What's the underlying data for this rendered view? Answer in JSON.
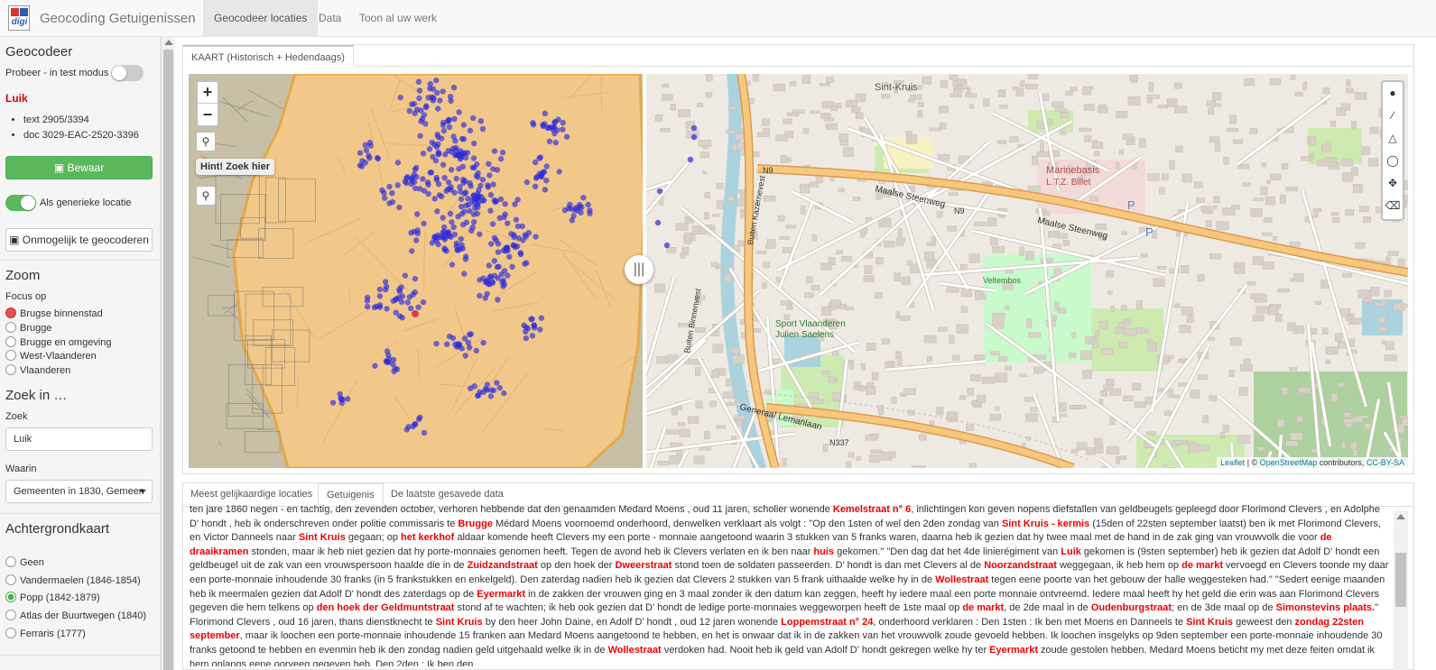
{
  "app": {
    "logo_text": "digi",
    "title": "Geocoding Getuigenissen",
    "nav": [
      {
        "label": "Geocodeer locaties"
      },
      {
        "label": "Data"
      },
      {
        "label": "Toon al uw werk"
      }
    ]
  },
  "sidebar": {
    "geocodeer": {
      "heading": "Geocodeer",
      "test_mode_label": "Probeer - in test modus",
      "test_mode": false,
      "location": "Luik",
      "details": [
        "text 2905/3394",
        "doc 3029-EAC-2520-3396"
      ],
      "save_label": "Bewaar",
      "generic_label": "Als generieke locatie",
      "generic": true,
      "impossible_label": "Onmogelijk te geocoderen"
    },
    "zoom": {
      "heading": "Zoom",
      "focus_label": "Focus op",
      "options": [
        "Brugse binnenstad",
        "Brugge",
        "Brugge en omgeving",
        "West-Vlaanderen",
        "Vlaanderen"
      ],
      "selected": 0
    },
    "search": {
      "heading": "Zoek in …",
      "query_label": "Zoek",
      "query_value": "Luik",
      "where_label": "Waarin",
      "where_value": "Gemeenten in 1830, Gemeen"
    },
    "background": {
      "heading": "Achtergrondkaart",
      "options": [
        "Geen",
        "Vandermaelen (1846-1854)",
        "Popp (1842-1879)",
        "Atlas der Buurtwegen (1840)",
        "Ferraris (1777)"
      ],
      "selected": 2
    }
  },
  "map_panel": {
    "tab": "KAART (Historisch + Hedendaags)",
    "zoom_in": "+",
    "zoom_out": "−",
    "hint": "Hint! Zoek hier",
    "attribution": {
      "leaflet": "Leaflet",
      "sep": "| ©",
      "osm": "OpenStreetMap",
      "contrib": "contributors,",
      "license": "CC-BY-SA"
    },
    "labels": {
      "sint_kruis": "Sint-Kruis",
      "maalse_1": "Maalse Steenweg",
      "maalse_2": "Maalse Steenweg",
      "marinebasis": "Marinebasis",
      "ltz": "L.T.Z. Billet",
      "sport": "Sport Vlaanderen",
      "saelens": "Julien Saelens",
      "veltembos": "Veltembos",
      "leman": "Generaal Lemanlaan",
      "kazernevest": "Buiten Kazernevest",
      "binnenvest": "Buiten Binnenvest",
      "n9a": "N9",
      "n9b": "N9",
      "n337": "N337",
      "p": "P"
    },
    "colors": {
      "dots": "#2b2bdc",
      "historic": "#f2c88a",
      "road": "#f7c77e"
    }
  },
  "bottom_panel": {
    "tabs": [
      {
        "label": "Meest gelijkaardige locaties"
      },
      {
        "label": "Getuigenis"
      },
      {
        "label": "De laatste gesavede data"
      }
    ],
    "active_tab": 1,
    "segments": [
      {
        "t": "ten jare 1860 negen - en tachtig, den zevenden october, verhoren hebbende dat den genaamden Medard Moens , oud 11 jaren, scholier wonende "
      },
      {
        "t": "Kemelstraat n° 6",
        "h": true
      },
      {
        "t": ", inlichtingen kon geven nopens diefstallen van geldbeugels gepleegd door Florimond Clevers , en Adolphe D' hondt , heb ik onderschreven onder politie commissaris te "
      },
      {
        "t": "Brugge",
        "h": true
      },
      {
        "t": " Médard Moens voornoemd onderhoord, denwelken verklaart als volgt : \"Op den 1sten of wel den 2den zondag van "
      },
      {
        "t": "Sint Kruis - kermis",
        "h": true
      },
      {
        "t": " (15den of 22sten september laatst) ben ik met Florimond Clevers, en Victor Danneels naar "
      },
      {
        "t": "Sint Kruis",
        "h": true
      },
      {
        "t": " gegaan; op "
      },
      {
        "t": "het kerkhof",
        "h": true
      },
      {
        "t": " aldaar komende heeft Clevers my een porte - monnaie aangetoond waarin 3 stukken van 5 franks waren, daarna heb ik gezien dat hy twee maal met de hand in de zak ging van vrouwvolk die voor "
      },
      {
        "t": "de draaikramen",
        "h": true
      },
      {
        "t": " stonden, maar ik heb niet gezien dat hy porte-monnaies genomen heeft. Tegen de avond heb ik Clevers verlaten en ik ben naar "
      },
      {
        "t": "huis",
        "h": true
      },
      {
        "t": " gekomen.\" \"Den dag dat het 4de linierégiment van "
      },
      {
        "t": "Luik",
        "h": true
      },
      {
        "t": " gekomen is (9sten september) heb ik gezien dat Adolf D' hondt een geldbeugel uit de zak van een vrouwspersoon haalde die in de "
      },
      {
        "t": "Zuidzandstraat",
        "h": true
      },
      {
        "t": " op den hoek der "
      },
      {
        "t": "Dweerstraat",
        "h": true
      },
      {
        "t": " stond toen de soldaten passeerden. D' hondt is dan met Clevers al de "
      },
      {
        "t": "Noorzandstraat",
        "h": true
      },
      {
        "t": " weggegaan, ik heb hem op "
      },
      {
        "t": "de markt",
        "h": true
      },
      {
        "t": " vervoegd en Clevers toonde my daar een porte-monnaie inhoudende 30 franks (in 5 frankstukken en enkelgeld). Den zaterdag nadien heb ik gezien dat Clevers 2 stukken van 5 frank uithaalde welke hy in de "
      },
      {
        "t": "Wollestraat",
        "h": true
      },
      {
        "t": " tegen eene poorte van het gebouw der halle weggesteken had.\" \"Sedert eenige maanden heb ik meermalen gezien dat Adolf D' hondt des zaterdags op de "
      },
      {
        "t": "Eyermarkt",
        "h": true
      },
      {
        "t": " in de zakken der vrouwen ging en 3 maal zonder ik den datum kan zeggen, heeft hy iedere maal een porte monnaie ontvreemd. Iedere maal heeft hy het geld die erin was aan Florimond Clevers gegeven die hem telkens op "
      },
      {
        "t": "den hoek der Geldmuntstraat",
        "h": true
      },
      {
        "t": " stond af te wachten; ik heb ook gezien dat D' hondt de ledige porte-monnaies weggeworpen heeft de 1ste maal op "
      },
      {
        "t": "de markt",
        "h": true
      },
      {
        "t": ", de 2de maal in de "
      },
      {
        "t": "Oudenburgstraat",
        "h": true
      },
      {
        "t": "; en de 3de maal op de "
      },
      {
        "t": "Simonstevins plaats.",
        "h": true
      },
      {
        "t": "\" Florimond Clevers , oud 16 jaren, thans dienstknecht te "
      },
      {
        "t": "Sint Kruis",
        "h": true
      },
      {
        "t": " by den heer John Daine, en Adolf D' hondt , oud 12 jaren wonende "
      },
      {
        "t": "Loppemstraat n° 24",
        "h": true
      },
      {
        "t": ", onderhoord verklaren : Den 1sten : Ik ben met Moens en Danneels te "
      },
      {
        "t": "Sint Kruis",
        "h": true
      },
      {
        "t": " geweest den "
      },
      {
        "t": "zondag 22sten september",
        "h": true
      },
      {
        "t": ", maar ik loochen een porte-monnaie inhoudende 15 franken aan Medard Moens aangetoond te hebben, en het is onwaar dat ik in de zakken van het vrouwvolk zoude gevoeld hebben. Ik loochen insgelyks op 9den september een porte-monnaie inhoudende 30 franks getoond te hebben en evenmin heb ik den zondag nadien geld uitgehaald welke ik in de "
      },
      {
        "t": "Wollestraat",
        "h": true
      },
      {
        "t": " verdoken had. Nooit heb ik geld van Adolf D' hondt gekregen welke hy ter "
      },
      {
        "t": "Eyermarkt",
        "h": true
      },
      {
        "t": " zoude gestolen hebben. Medard Moens beticht my met deze feiten omdat ik hem onlangs eene oorveeg gegeven heb. Den 2den : Ik ben den"
      }
    ]
  }
}
